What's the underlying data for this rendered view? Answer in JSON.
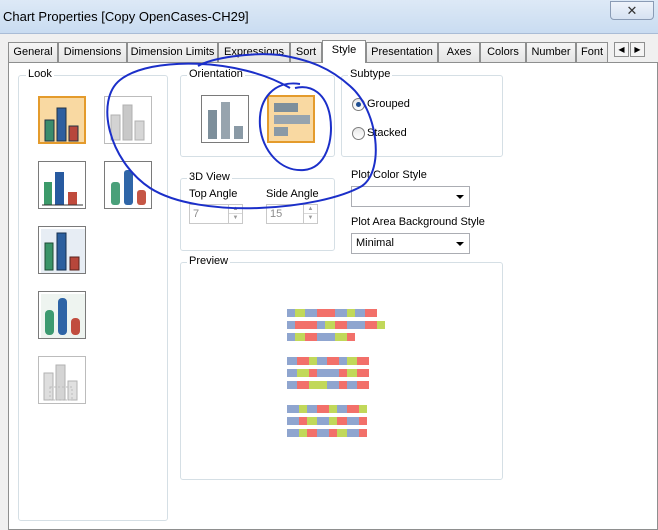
{
  "window": {
    "title": "Chart Properties [Copy OpenCases-CH29]",
    "close_glyph": "✕"
  },
  "tabs": [
    {
      "label": "General"
    },
    {
      "label": "Dimensions"
    },
    {
      "label": "Dimension Limits"
    },
    {
      "label": "Expressions"
    },
    {
      "label": "Sort"
    },
    {
      "label": "Style",
      "active": true
    },
    {
      "label": "Presentation"
    },
    {
      "label": "Axes"
    },
    {
      "label": "Colors"
    },
    {
      "label": "Number"
    },
    {
      "label": "Font"
    }
  ],
  "tab_scroll": {
    "left": "◀",
    "right": "▶"
  },
  "look": {
    "label": "Look",
    "icons": [
      "bar-chart-blue-selected",
      "bar-chart-ghost",
      "bar-chart-flat-green",
      "bar-chart-3d-cylinders",
      "bar-chart-3d-box",
      "bar-chart-3d-cylinders-dark",
      "bar-chart-ghost-3d"
    ]
  },
  "orientation": {
    "label": "Orientation",
    "options": [
      "vertical",
      "horizontal"
    ],
    "selected": "horizontal"
  },
  "view3d": {
    "label": "3D View",
    "top_angle_label": "Top Angle",
    "top_angle_value": "7",
    "side_angle_label": "Side Angle",
    "side_angle_value": "15"
  },
  "subtype": {
    "label": "Subtype",
    "options": [
      {
        "label": "Grouped",
        "checked": true
      },
      {
        "label": "Stacked",
        "checked": false
      }
    ]
  },
  "plot_color_style": {
    "label": "Plot Color Style",
    "value": ""
  },
  "plot_area_bg": {
    "label": "Plot Area Background Style",
    "value": "Minimal"
  },
  "preview": {
    "label": "Preview"
  },
  "colors": {
    "blue": "#8fa5cf",
    "red": "#f2706a",
    "green": "#c1d85a",
    "accent": "#e49b2c",
    "annotation": "#1b2fc9"
  }
}
